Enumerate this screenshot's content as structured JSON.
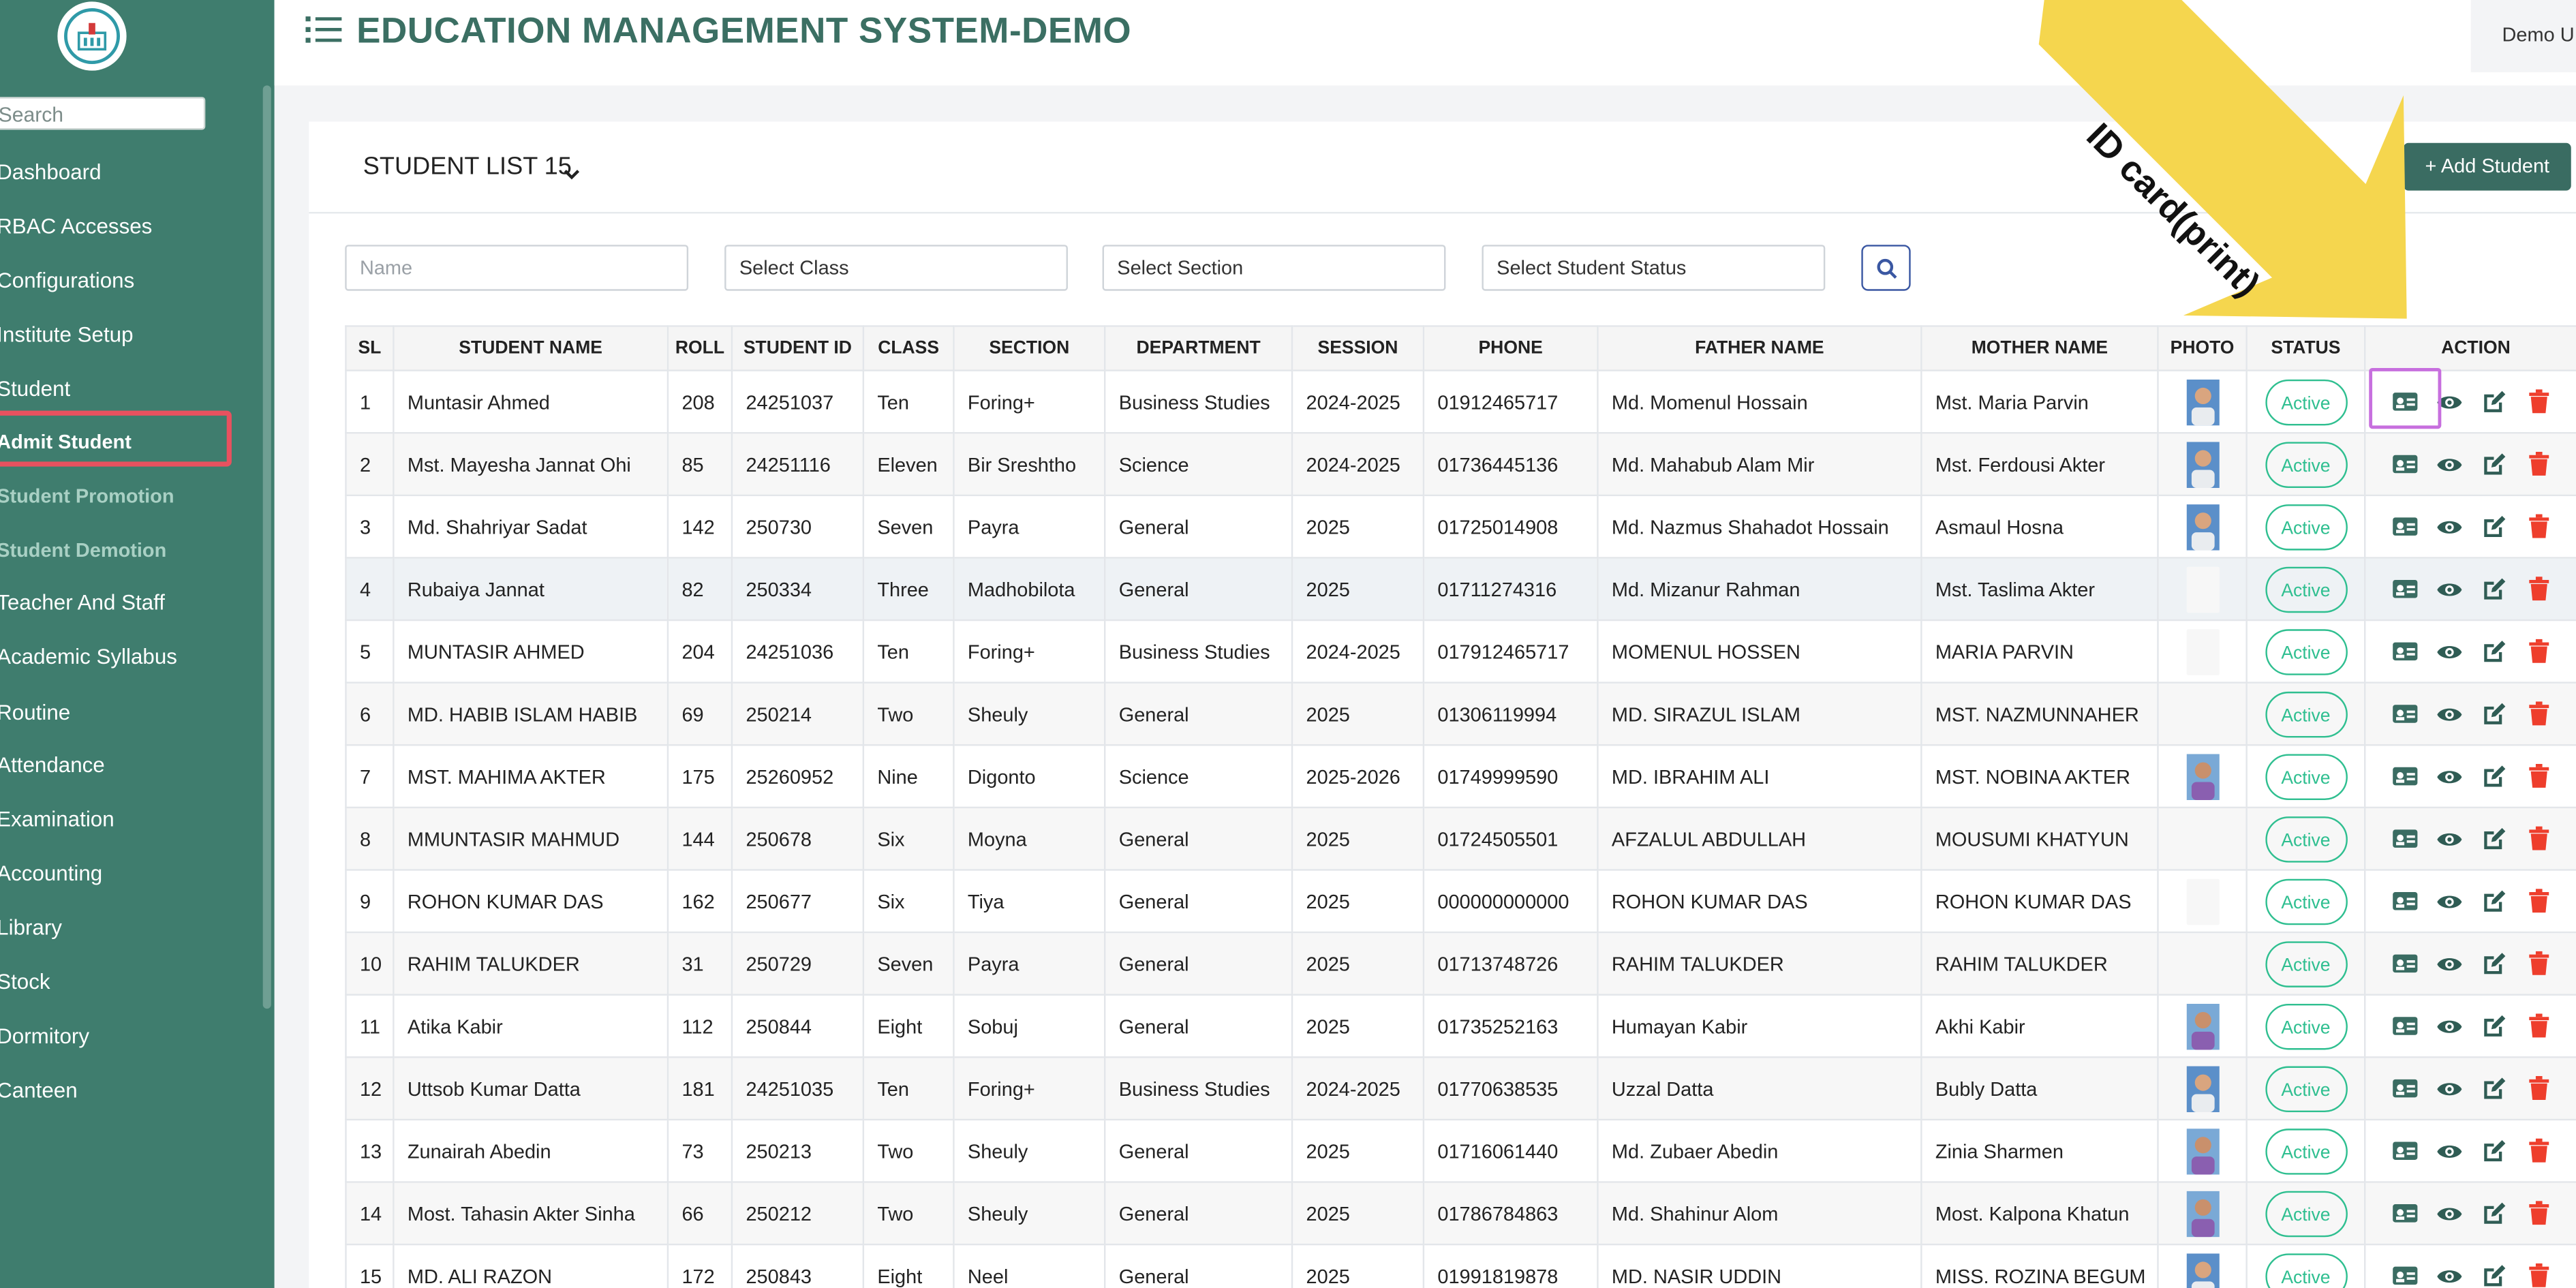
{
  "app": {
    "title": "EDUCATION MANAGEMENT SYSTEM-DEMO",
    "user_label": "Demo U"
  },
  "sidebar": {
    "search_placeholder": "Search",
    "items": [
      {
        "label": "Dashboard"
      },
      {
        "label": "RBAC Accesses"
      },
      {
        "label": "Configurations"
      },
      {
        "label": "Institute Setup"
      },
      {
        "label": "Student"
      },
      {
        "label": "Admit Student"
      },
      {
        "label": "Student Promotion"
      },
      {
        "label": "Student Demotion"
      },
      {
        "label": "Teacher And Staff"
      },
      {
        "label": "Academic Syllabus"
      },
      {
        "label": "Routine"
      },
      {
        "label": "Attendance"
      },
      {
        "label": "Examination"
      },
      {
        "label": "Accounting"
      },
      {
        "label": "Library"
      },
      {
        "label": "Stock"
      },
      {
        "label": "Dormitory"
      },
      {
        "label": "Canteen"
      }
    ]
  },
  "list": {
    "title": "STUDENT LIST 15",
    "add_button": "+ Add Student",
    "filters": {
      "name_placeholder": "Name",
      "class": "Select Class",
      "section": "Select Section",
      "status": "Select Student Status"
    },
    "columns": [
      "SL",
      "STUDENT NAME",
      "ROLL",
      "STUDENT ID",
      "CLASS",
      "SECTION",
      "DEPARTMENT",
      "SESSION",
      "PHONE",
      "FATHER NAME",
      "MOTHER NAME",
      "PHOTO",
      "STATUS",
      "ACTION"
    ],
    "rows": [
      {
        "sl": "1",
        "name": "Muntasir Ahmed",
        "roll": "208",
        "sid": "24251037",
        "class": "Ten",
        "section": "Foring+",
        "dept": "Business Studies",
        "session": "2024-2025",
        "phone": "01912465717",
        "father": "Md. Momenul Hossain",
        "mother": "Mst. Maria Parvin",
        "photo": "boy-photo",
        "status": "Active"
      },
      {
        "sl": "2",
        "name": "Mst. Mayesha Jannat Ohi",
        "roll": "85",
        "sid": "24251116",
        "class": "Eleven",
        "section": "Bir Sreshtho",
        "dept": "Science",
        "session": "2024-2025",
        "phone": "01736445136",
        "father": "Md. Mahabub Alam Mir",
        "mother": "Mst. Ferdousi Akter",
        "photo": "boy-photo",
        "status": "Active"
      },
      {
        "sl": "3",
        "name": "Md. Shahriyar Sadat",
        "roll": "142",
        "sid": "250730",
        "class": "Seven",
        "section": "Payra",
        "dept": "General",
        "session": "2025",
        "phone": "01725014908",
        "father": "Md. Nazmus Shahadot Hossain",
        "mother": "Asmaul Hosna",
        "photo": "boy-photo",
        "status": "Active"
      },
      {
        "sl": "4",
        "name": "Rubaiya Jannat",
        "roll": "82",
        "sid": "250334",
        "class": "Three",
        "section": "Madhobilota",
        "dept": "General",
        "session": "2025",
        "phone": "01711274316",
        "father": "Md. Mizanur Rahman",
        "mother": "Mst. Taslima Akter",
        "photo": "empty",
        "status": "Active"
      },
      {
        "sl": "5",
        "name": "MUNTASIR AHMED",
        "roll": "204",
        "sid": "24251036",
        "class": "Ten",
        "section": "Foring+",
        "dept": "Business Studies",
        "session": "2024-2025",
        "phone": "017912465717",
        "father": "MOMENUL HOSSEN",
        "mother": "MARIA PARVIN",
        "photo": "empty",
        "status": "Active"
      },
      {
        "sl": "6",
        "name": "MD. HABIB ISLAM HABIB",
        "roll": "69",
        "sid": "250214",
        "class": "Two",
        "section": "Sheuly",
        "dept": "General",
        "session": "2025",
        "phone": "01306119994",
        "father": "MD. SIRAZUL ISLAM",
        "mother": "MST. NAZMUNNAHER",
        "photo": "none",
        "status": "Active"
      },
      {
        "sl": "7",
        "name": "MST. MAHIMA AKTER",
        "roll": "175",
        "sid": "25260952",
        "class": "Nine",
        "section": "Digonto",
        "dept": "Science",
        "session": "2025-2026",
        "phone": "01749999590",
        "father": "MD. IBRAHIM ALI",
        "mother": "MST. NOBINA AKTER",
        "photo": "girl-photo",
        "status": "Active"
      },
      {
        "sl": "8",
        "name": "MMUNTASIR MAHMUD",
        "roll": "144",
        "sid": "250678",
        "class": "Six",
        "section": "Moyna",
        "dept": "General",
        "session": "2025",
        "phone": "01724505501",
        "father": "AFZALUL ABDULLAH",
        "mother": "MOUSUMI KHATYUN",
        "photo": "none",
        "status": "Active"
      },
      {
        "sl": "9",
        "name": "ROHON KUMAR DAS",
        "roll": "162",
        "sid": "250677",
        "class": "Six",
        "section": "Tiya",
        "dept": "General",
        "session": "2025",
        "phone": "000000000000",
        "father": "ROHON KUMAR DAS",
        "mother": "ROHON KUMAR DAS",
        "photo": "empty",
        "status": "Active"
      },
      {
        "sl": "10",
        "name": "RAHIM TALUKDER",
        "roll": "31",
        "sid": "250729",
        "class": "Seven",
        "section": "Payra",
        "dept": "General",
        "session": "2025",
        "phone": "01713748726",
        "father": "RAHIM TALUKDER",
        "mother": "RAHIM TALUKDER",
        "photo": "none",
        "status": "Active"
      },
      {
        "sl": "11",
        "name": "Atika Kabir",
        "roll": "112",
        "sid": "250844",
        "class": "Eight",
        "section": "Sobuj",
        "dept": "General",
        "session": "2025",
        "phone": "01735252163",
        "father": "Humayan Kabir",
        "mother": "Akhi Kabir",
        "photo": "girl-photo",
        "status": "Active"
      },
      {
        "sl": "12",
        "name": "Uttsob Kumar Datta",
        "roll": "181",
        "sid": "24251035",
        "class": "Ten",
        "section": "Foring+",
        "dept": "Business Studies",
        "session": "2024-2025",
        "phone": "01770638535",
        "father": "Uzzal Datta",
        "mother": "Bubly Datta",
        "photo": "boy-photo",
        "status": "Active"
      },
      {
        "sl": "13",
        "name": "Zunairah Abedin",
        "roll": "73",
        "sid": "250213",
        "class": "Two",
        "section": "Sheuly",
        "dept": "General",
        "session": "2025",
        "phone": "01716061440",
        "father": "Md. Zubaer Abedin",
        "mother": "Zinia Sharmen",
        "photo": "girl-photo",
        "status": "Active"
      },
      {
        "sl": "14",
        "name": "Most. Tahasin Akter Sinha",
        "roll": "66",
        "sid": "250212",
        "class": "Two",
        "section": "Sheuly",
        "dept": "General",
        "session": "2025",
        "phone": "01786784863",
        "father": "Md. Shahinur Alom",
        "mother": "Most. Kalpona Khatun",
        "photo": "girl-photo",
        "status": "Active"
      },
      {
        "sl": "15",
        "name": "MD. ALI RAZON",
        "roll": "172",
        "sid": "250843",
        "class": "Eight",
        "section": "Neel",
        "dept": "General",
        "session": "2025",
        "phone": "01991819878",
        "father": "MD. NASIR UDDIN",
        "mother": "MISS. ROZINA BEGUM",
        "photo": "boy-photo",
        "status": "Active"
      }
    ]
  },
  "annotation": {
    "label": "ID card(print)",
    "arrow_color": "#f5d64e",
    "highlight_color": "#c76fde",
    "sidebar_highlight_color": "#e8515f"
  },
  "colors": {
    "sidebar_bg": "#3f7d6e",
    "title": "#3b6f63",
    "active_badge": "#2fbf90",
    "id_card_icon": "#3a6c62",
    "view_icon": "#2f5c54",
    "edit_icon": "#2f5c54",
    "delete_icon": "#ee3e2c",
    "add_button_bg": "#3a6c62"
  },
  "icons": {
    "menu": "list-menu-icon",
    "chevron": "chevron-down-icon",
    "search": "search-icon",
    "id_card": "id-card-icon",
    "view": "eye-icon",
    "edit": "edit-icon",
    "delete": "trash-icon"
  }
}
